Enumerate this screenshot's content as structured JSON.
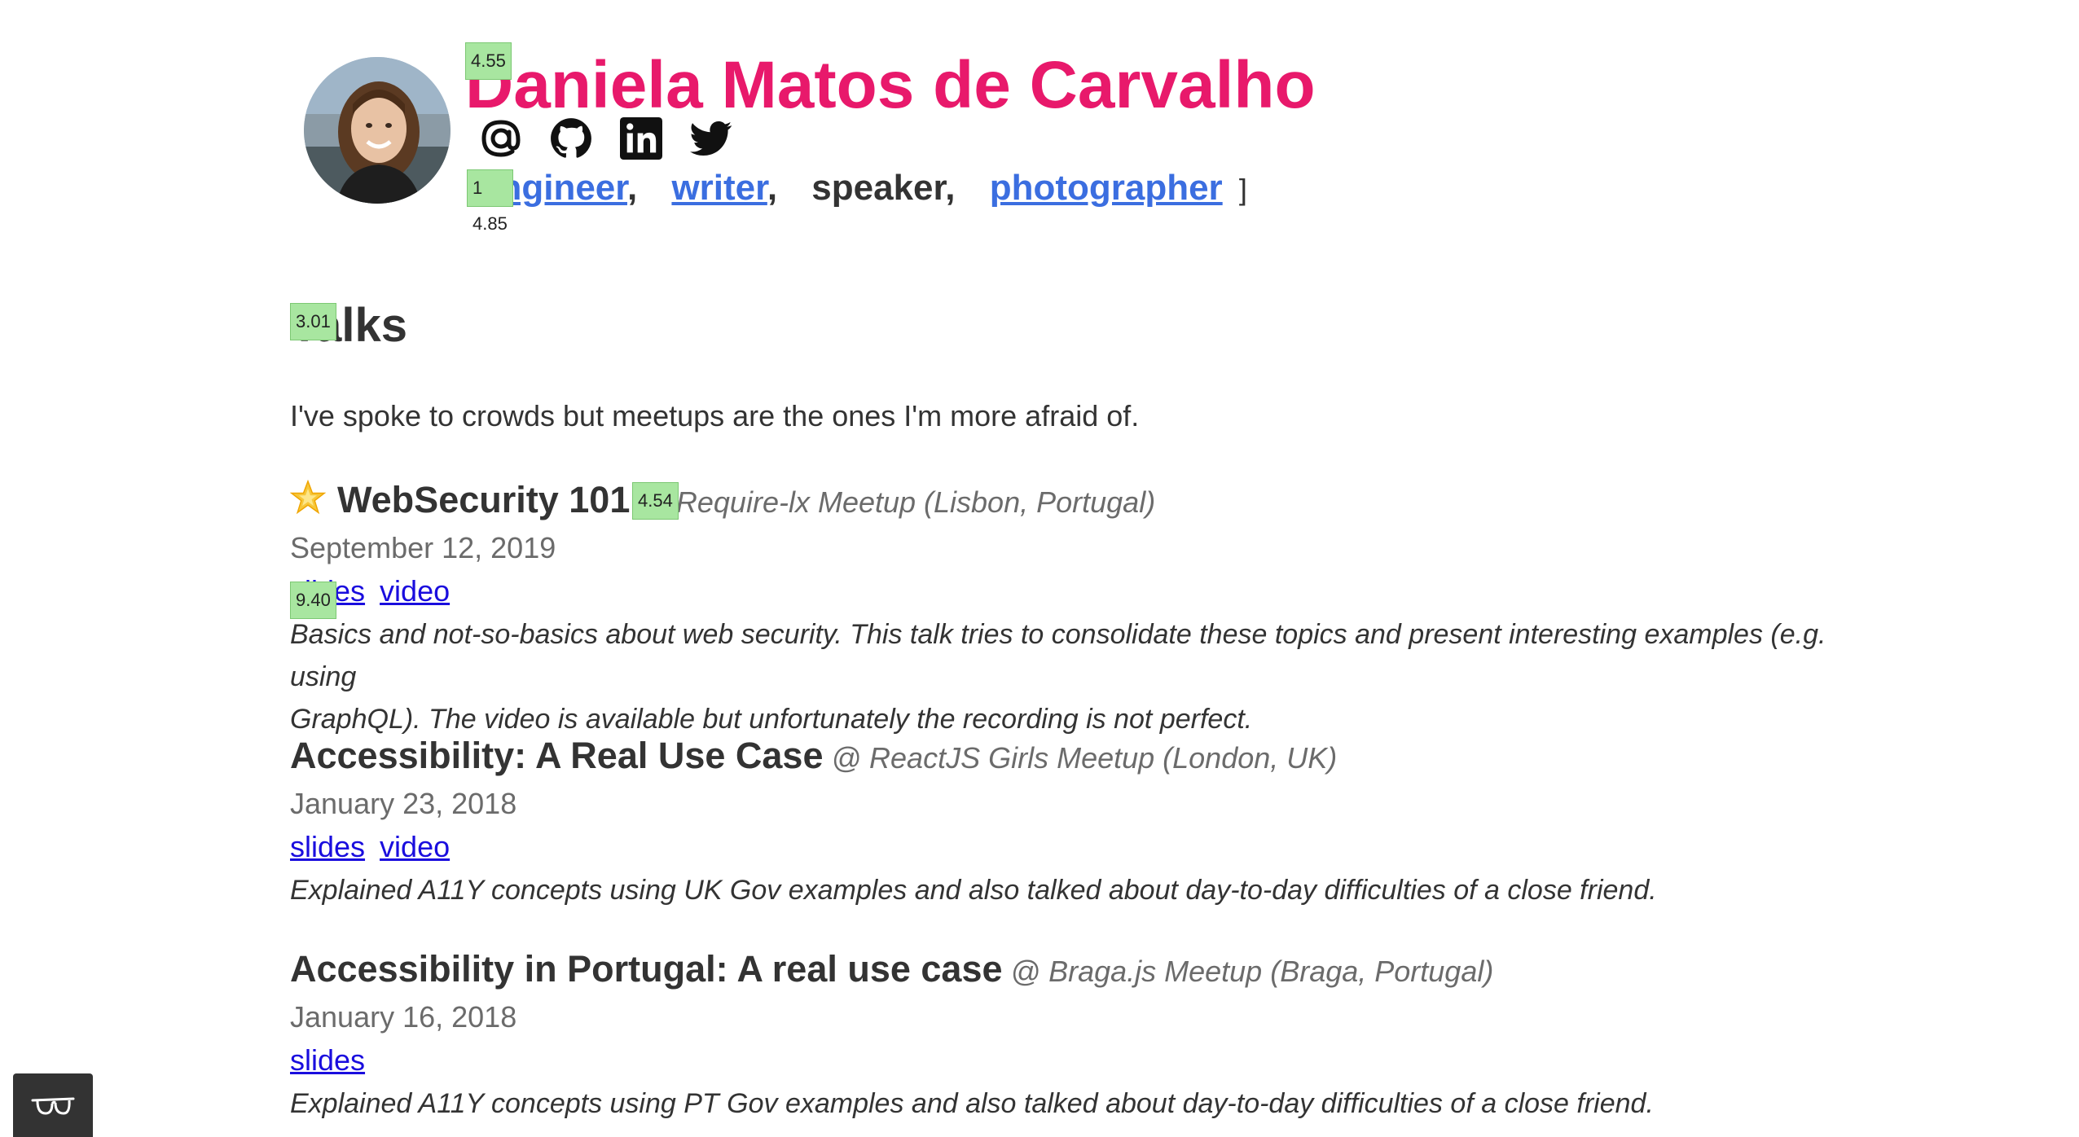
{
  "header": {
    "name": "Daniela Matos de Carvalho",
    "icons": [
      "at-icon",
      "github-icon",
      "linkedin-icon",
      "twitter-icon"
    ],
    "roles": [
      {
        "label": "engineer",
        "link": true
      },
      {
        "label": "writer",
        "link": true
      },
      {
        "label": "speaker",
        "link": false
      },
      {
        "label": "photographer",
        "link": true
      }
    ],
    "role_separator": ",",
    "bracket": "]",
    "name_color": "#e8196b",
    "link_color": "#3b6ee0"
  },
  "badges": {
    "name": "4.55",
    "roles": "1 4.85",
    "talks_heading": "3.01",
    "websecurity_venue": "4.54",
    "websecurity_links": "9.40"
  },
  "section": {
    "title": "Talks",
    "intro": "I've spoke to crowds but meetups are the ones I'm more afraid of."
  },
  "talks": [
    {
      "title": "WebSecurity 101",
      "starred": true,
      "venue": "@ Require-lx Meetup (Lisbon, Portugal)",
      "date": "September 12, 2019",
      "links": [
        "slides",
        "video"
      ],
      "description_line1": "Basics and not-so-basics about web security. This talk tries to consolidate these topics and present interesting examples (e.g. using",
      "description_line2": "GraphQL). The video is available but unfortunately the recording is not perfect."
    },
    {
      "title": "Accessibility: A Real Use Case",
      "starred": false,
      "venue": "@ ReactJS Girls Meetup (London, UK)",
      "date": "January 23, 2018",
      "links": [
        "slides",
        "video"
      ],
      "description_line1": "Explained A11Y concepts using UK Gov examples and also talked about day-to-day difficulties of a close friend."
    },
    {
      "title": "Accessibility in Portugal: A real use case",
      "starred": false,
      "venue": "@ Braga.js Meetup (Braga, Portugal)",
      "date": "January 16, 2018",
      "links": [
        "slides"
      ],
      "description_line1": "Explained A11Y concepts using PT Gov examples and also talked about day-to-day difficulties of a close friend."
    }
  ],
  "accessibility_widget": {
    "icon": "glasses-icon"
  }
}
